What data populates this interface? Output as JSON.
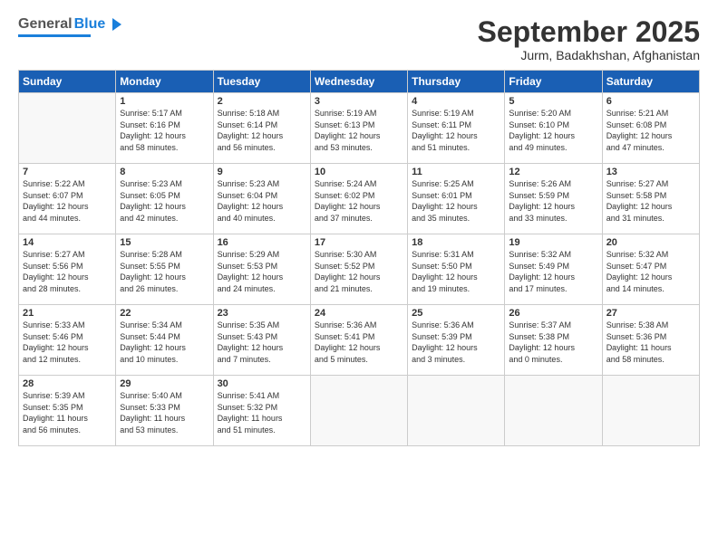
{
  "header": {
    "logo_general": "General",
    "logo_blue": "Blue",
    "month_title": "September 2025",
    "location": "Jurm, Badakhshan, Afghanistan"
  },
  "weekdays": [
    "Sunday",
    "Monday",
    "Tuesday",
    "Wednesday",
    "Thursday",
    "Friday",
    "Saturday"
  ],
  "days": [
    {
      "date": "",
      "info": ""
    },
    {
      "date": "1",
      "info": "Sunrise: 5:17 AM\nSunset: 6:16 PM\nDaylight: 12 hours\nand 58 minutes."
    },
    {
      "date": "2",
      "info": "Sunrise: 5:18 AM\nSunset: 6:14 PM\nDaylight: 12 hours\nand 56 minutes."
    },
    {
      "date": "3",
      "info": "Sunrise: 5:19 AM\nSunset: 6:13 PM\nDaylight: 12 hours\nand 53 minutes."
    },
    {
      "date": "4",
      "info": "Sunrise: 5:19 AM\nSunset: 6:11 PM\nDaylight: 12 hours\nand 51 minutes."
    },
    {
      "date": "5",
      "info": "Sunrise: 5:20 AM\nSunset: 6:10 PM\nDaylight: 12 hours\nand 49 minutes."
    },
    {
      "date": "6",
      "info": "Sunrise: 5:21 AM\nSunset: 6:08 PM\nDaylight: 12 hours\nand 47 minutes."
    },
    {
      "date": "7",
      "info": "Sunrise: 5:22 AM\nSunset: 6:07 PM\nDaylight: 12 hours\nand 44 minutes."
    },
    {
      "date": "8",
      "info": "Sunrise: 5:23 AM\nSunset: 6:05 PM\nDaylight: 12 hours\nand 42 minutes."
    },
    {
      "date": "9",
      "info": "Sunrise: 5:23 AM\nSunset: 6:04 PM\nDaylight: 12 hours\nand 40 minutes."
    },
    {
      "date": "10",
      "info": "Sunrise: 5:24 AM\nSunset: 6:02 PM\nDaylight: 12 hours\nand 37 minutes."
    },
    {
      "date": "11",
      "info": "Sunrise: 5:25 AM\nSunset: 6:01 PM\nDaylight: 12 hours\nand 35 minutes."
    },
    {
      "date": "12",
      "info": "Sunrise: 5:26 AM\nSunset: 5:59 PM\nDaylight: 12 hours\nand 33 minutes."
    },
    {
      "date": "13",
      "info": "Sunrise: 5:27 AM\nSunset: 5:58 PM\nDaylight: 12 hours\nand 31 minutes."
    },
    {
      "date": "14",
      "info": "Sunrise: 5:27 AM\nSunset: 5:56 PM\nDaylight: 12 hours\nand 28 minutes."
    },
    {
      "date": "15",
      "info": "Sunrise: 5:28 AM\nSunset: 5:55 PM\nDaylight: 12 hours\nand 26 minutes."
    },
    {
      "date": "16",
      "info": "Sunrise: 5:29 AM\nSunset: 5:53 PM\nDaylight: 12 hours\nand 24 minutes."
    },
    {
      "date": "17",
      "info": "Sunrise: 5:30 AM\nSunset: 5:52 PM\nDaylight: 12 hours\nand 21 minutes."
    },
    {
      "date": "18",
      "info": "Sunrise: 5:31 AM\nSunset: 5:50 PM\nDaylight: 12 hours\nand 19 minutes."
    },
    {
      "date": "19",
      "info": "Sunrise: 5:32 AM\nSunset: 5:49 PM\nDaylight: 12 hours\nand 17 minutes."
    },
    {
      "date": "20",
      "info": "Sunrise: 5:32 AM\nSunset: 5:47 PM\nDaylight: 12 hours\nand 14 minutes."
    },
    {
      "date": "21",
      "info": "Sunrise: 5:33 AM\nSunset: 5:46 PM\nDaylight: 12 hours\nand 12 minutes."
    },
    {
      "date": "22",
      "info": "Sunrise: 5:34 AM\nSunset: 5:44 PM\nDaylight: 12 hours\nand 10 minutes."
    },
    {
      "date": "23",
      "info": "Sunrise: 5:35 AM\nSunset: 5:43 PM\nDaylight: 12 hours\nand 7 minutes."
    },
    {
      "date": "24",
      "info": "Sunrise: 5:36 AM\nSunset: 5:41 PM\nDaylight: 12 hours\nand 5 minutes."
    },
    {
      "date": "25",
      "info": "Sunrise: 5:36 AM\nSunset: 5:39 PM\nDaylight: 12 hours\nand 3 minutes."
    },
    {
      "date": "26",
      "info": "Sunrise: 5:37 AM\nSunset: 5:38 PM\nDaylight: 12 hours\nand 0 minutes."
    },
    {
      "date": "27",
      "info": "Sunrise: 5:38 AM\nSunset: 5:36 PM\nDaylight: 11 hours\nand 58 minutes."
    },
    {
      "date": "28",
      "info": "Sunrise: 5:39 AM\nSunset: 5:35 PM\nDaylight: 11 hours\nand 56 minutes."
    },
    {
      "date": "29",
      "info": "Sunrise: 5:40 AM\nSunset: 5:33 PM\nDaylight: 11 hours\nand 53 minutes."
    },
    {
      "date": "30",
      "info": "Sunrise: 5:41 AM\nSunset: 5:32 PM\nDaylight: 11 hours\nand 51 minutes."
    },
    {
      "date": "",
      "info": ""
    },
    {
      "date": "",
      "info": ""
    },
    {
      "date": "",
      "info": ""
    },
    {
      "date": "",
      "info": ""
    }
  ]
}
